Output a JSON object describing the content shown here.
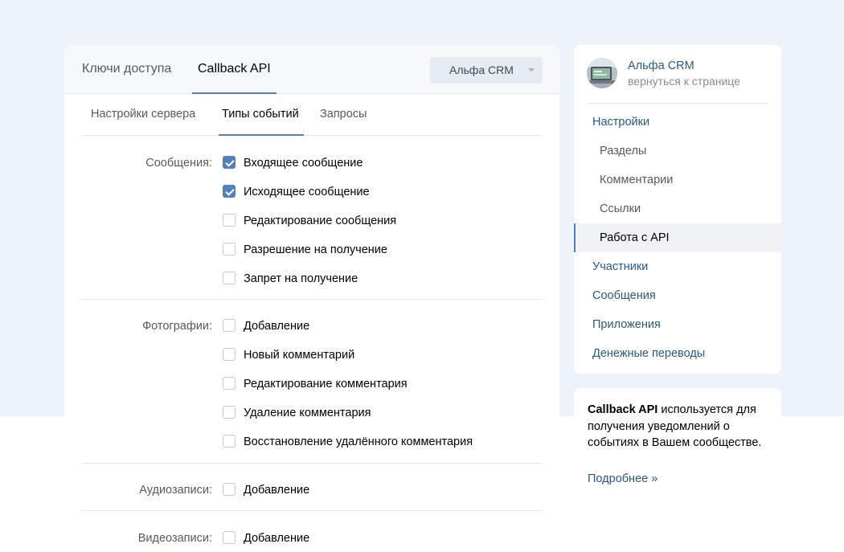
{
  "top_tabs": [
    "Ключи доступа",
    "Callback API"
  ],
  "group_select": {
    "value": "Альфа CRM"
  },
  "sub_tabs": [
    "Настройки сервера",
    "Типы событий",
    "Запросы"
  ],
  "sections": [
    {
      "label": "Сообщения:",
      "items": [
        {
          "label": "Входящее сообщение",
          "checked": true
        },
        {
          "label": "Исходящее сообщение",
          "checked": true
        },
        {
          "label": "Редактирование сообщения",
          "checked": false
        },
        {
          "label": "Разрешение на получение",
          "checked": false
        },
        {
          "label": "Запрет на получение",
          "checked": false
        }
      ]
    },
    {
      "label": "Фотографии:",
      "items": [
        {
          "label": "Добавление",
          "checked": false
        },
        {
          "label": "Новый комментарий",
          "checked": false
        },
        {
          "label": "Редактирование комментария",
          "checked": false
        },
        {
          "label": "Удаление комментария",
          "checked": false
        },
        {
          "label": "Восстановление удалённого комментария",
          "checked": false
        }
      ]
    },
    {
      "label": "Аудиозаписи:",
      "items": [
        {
          "label": "Добавление",
          "checked": false
        }
      ]
    },
    {
      "label": "Видеозаписи:",
      "items": [
        {
          "label": "Добавление",
          "checked": false
        }
      ]
    }
  ],
  "sidebar": {
    "group_name": "Альфа CRM",
    "back_link": "вернуться к странице",
    "items": [
      {
        "label": "Настройки"
      },
      {
        "label": "Разделы"
      },
      {
        "label": "Комментарии"
      },
      {
        "label": "Ссылки"
      },
      {
        "label": "Работа с API"
      },
      {
        "label": "Участники"
      },
      {
        "label": "Сообщения"
      },
      {
        "label": "Приложения"
      },
      {
        "label": "Денежные переводы"
      }
    ]
  },
  "info": {
    "title": "Callback API",
    "text": " используется для получения уведомлений о событиях в Вашем сообществе.",
    "more": "Подробнее »"
  },
  "colors": {
    "accent": "#5181b8",
    "link": "#2a5885",
    "background": "#edf2fb"
  }
}
